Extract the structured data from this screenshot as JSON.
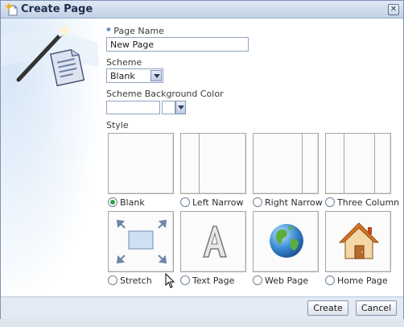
{
  "dialog": {
    "title": "Create Page",
    "close_label": "✕"
  },
  "form": {
    "page_name_required": "*",
    "page_name_label": "Page Name",
    "page_name_value": "New Page",
    "scheme_label": "Scheme",
    "scheme_value": "Blank",
    "bg_color_label": "Scheme Background Color",
    "bg_color_value": "",
    "style_label": "Style"
  },
  "styles": [
    {
      "label": "Blank",
      "selected": true,
      "icon": "blank-layout-icon"
    },
    {
      "label": "Left Narrow",
      "selected": false,
      "icon": "left-narrow-layout-icon"
    },
    {
      "label": "Right Narrow",
      "selected": false,
      "icon": "right-narrow-layout-icon"
    },
    {
      "label": "Three Column",
      "selected": false,
      "icon": "three-column-layout-icon"
    },
    {
      "label": "Stretch",
      "selected": false,
      "icon": "stretch-icon"
    },
    {
      "label": "Text Page",
      "selected": false,
      "icon": "text-page-icon"
    },
    {
      "label": "Web Page",
      "selected": false,
      "icon": "globe-icon"
    },
    {
      "label": "Home Page",
      "selected": false,
      "icon": "house-icon"
    }
  ],
  "footer": {
    "create_label": "Create",
    "cancel_label": "Cancel"
  },
  "colors": {
    "titlebar": "#c2d1e6",
    "radio_selected": "#34a144",
    "footer": "#e3eaf4"
  }
}
